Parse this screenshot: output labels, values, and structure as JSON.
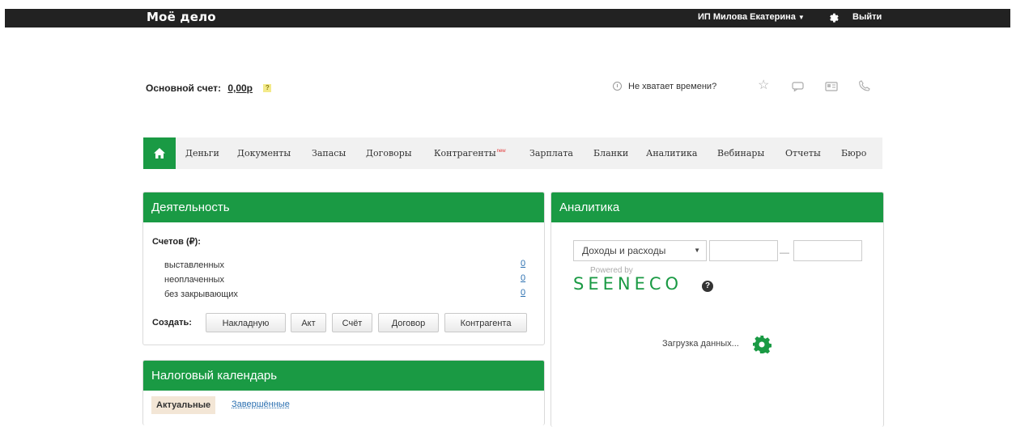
{
  "header": {
    "logo": "Моё дело",
    "user_name": "ИП Милова Екатерина",
    "logout": "Выйти"
  },
  "account": {
    "label": "Основной счет:",
    "value": "0,00р",
    "help_badge": "?"
  },
  "help": {
    "time_link": "Не хватает времени?"
  },
  "nav": {
    "items": [
      "Деньги",
      "Документы",
      "Запасы",
      "Договоры",
      "Контрагенты",
      "Зарплата",
      "Бланки",
      "Аналитика",
      "Вебинары",
      "Отчеты",
      "Бюро"
    ],
    "new_badge": "new"
  },
  "activity": {
    "title": "Деятельность",
    "invoices_title": "Счетов (₽):",
    "rows": [
      {
        "label": "выставленных",
        "value": "0"
      },
      {
        "label": "неоплаченных",
        "value": "0"
      },
      {
        "label": "без закрывающих",
        "value": "0"
      }
    ],
    "create_label": "Создать:",
    "buttons": [
      "Накладную",
      "Акт",
      "Счёт",
      "Договор",
      "Контрагента"
    ]
  },
  "analytics": {
    "title": "Аналитика",
    "select_value": "Доходы и расходы",
    "date_separator": "—",
    "powered_by": "Powered by",
    "brand": "SEENECO",
    "help": "?",
    "loading": "Загрузка данных..."
  },
  "tax_calendar": {
    "title": "Налоговый календарь",
    "tab_active": "Актуальные",
    "tab_done": "Завершённые"
  },
  "colors": {
    "brand_green": "#1a9a44",
    "top_bar": "#222222",
    "link_blue": "#2a6fb0"
  }
}
